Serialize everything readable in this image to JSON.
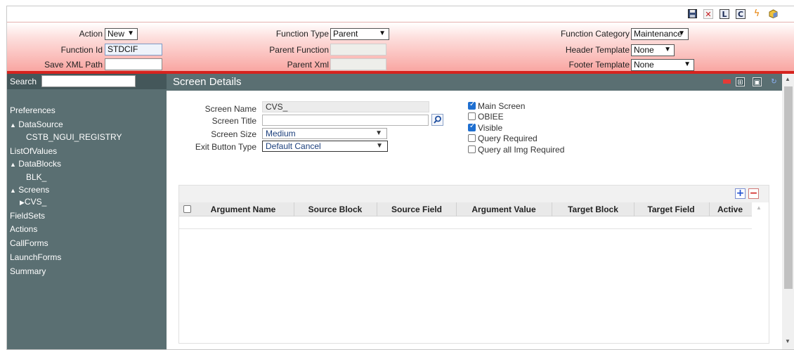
{
  "toolbar": {
    "icons": [
      "save-icon",
      "close-icon",
      "l-icon",
      "c-icon",
      "lightning-icon",
      "cube-icon"
    ],
    "l_label": "L",
    "c_label": "C"
  },
  "header": {
    "action_label": "Action",
    "action_value": "New",
    "function_id_label": "Function Id",
    "function_id_value": "STDCIF",
    "save_xml_path_label": "Save XML Path",
    "save_xml_path_value": "",
    "function_type_label": "Function Type",
    "function_type_value": "Parent",
    "parent_function_label": "Parent Function",
    "parent_function_value": "",
    "parent_xml_label": "Parent Xml",
    "parent_xml_value": "",
    "function_category_label": "Function Category",
    "function_category_value": "Maintenance",
    "header_template_label": "Header Template",
    "header_template_value": "None",
    "footer_template_label": "Footer Template",
    "footer_template_value": "None"
  },
  "sidebar": {
    "search_label": "Search",
    "search_value": "",
    "items": [
      {
        "label": "Preferences"
      },
      {
        "label": "DataSource",
        "expanded": true
      },
      {
        "label": "CSTB_NGUI_REGISTRY"
      },
      {
        "label": "ListOfValues"
      },
      {
        "label": "DataBlocks",
        "expanded": true
      },
      {
        "label": "BLK_"
      },
      {
        "label": "Screens",
        "expanded": true
      },
      {
        "label": "CVS_"
      },
      {
        "label": "FieldSets"
      },
      {
        "label": "Actions"
      },
      {
        "label": "CallForms"
      },
      {
        "label": "LaunchForms"
      },
      {
        "label": "Summary"
      }
    ]
  },
  "main": {
    "title": "Screen Details",
    "screen_name_label": "Screen Name",
    "screen_name_value": "CVS_",
    "screen_title_label": "Screen Title",
    "screen_title_value": "",
    "screen_size_label": "Screen Size",
    "screen_size_value": "Medium",
    "exit_button_type_label": "Exit Button Type",
    "exit_button_type_value": "Default Cancel",
    "checkboxes": [
      {
        "label": "Main Screen",
        "checked": true
      },
      {
        "label": "OBIEE",
        "checked": false
      },
      {
        "label": "Visible",
        "checked": true
      },
      {
        "label": "Query Required",
        "checked": false
      },
      {
        "label": "Query all Img Required",
        "checked": false
      }
    ]
  },
  "grid": {
    "add_symbol": "+",
    "remove_symbol": "−",
    "columns": [
      "Argument Name",
      "Source Block",
      "Source Field",
      "Argument Value",
      "Target Block",
      "Target Field",
      "Active"
    ],
    "rows": []
  },
  "colors": {
    "accent_red": "#d6231e",
    "sidebar_bg": "#5a6f72",
    "header_gradient_end": "#f9a6a2"
  }
}
